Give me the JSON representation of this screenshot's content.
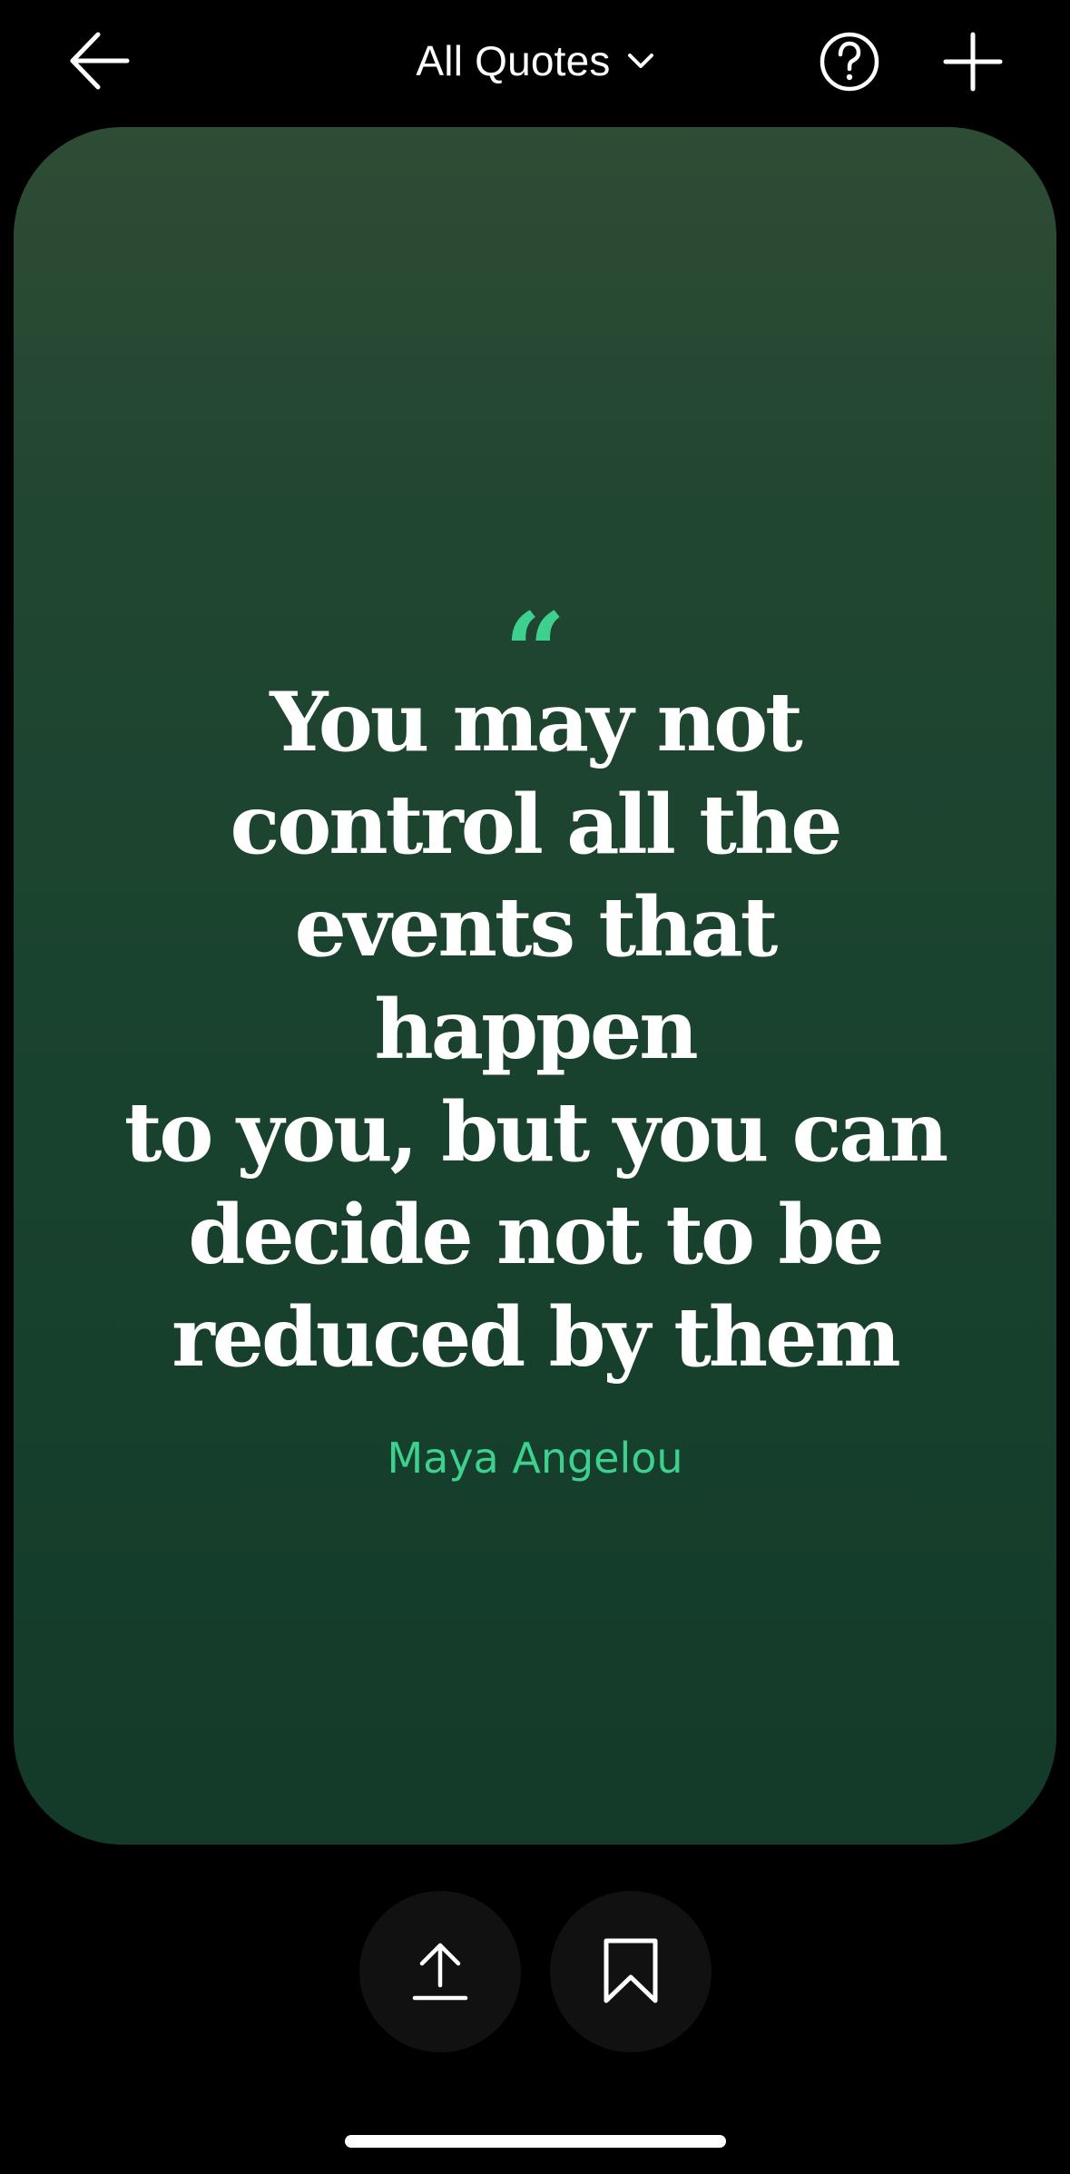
{
  "header": {
    "title": "All Quotes",
    "icons": {
      "back": "arrow-left-icon",
      "dropdown": "chevron-down-icon",
      "help": "question-circle-icon",
      "add": "plus-icon"
    }
  },
  "quote": {
    "mark": "“",
    "lines": [
      "You may not",
      "control all the",
      "events that happen",
      "to you, but you can",
      "decide not to be",
      "reduced by them"
    ],
    "author": "Maya Angelou"
  },
  "actions": {
    "share_icon": "share-upload-icon",
    "bookmark_icon": "bookmark-icon"
  },
  "colors": {
    "background": "#000000",
    "card_top": "#2f4c35",
    "card_bottom": "#143a29",
    "accent": "#3ed08e",
    "text": "#ffffff",
    "button_bg": "#111111"
  }
}
